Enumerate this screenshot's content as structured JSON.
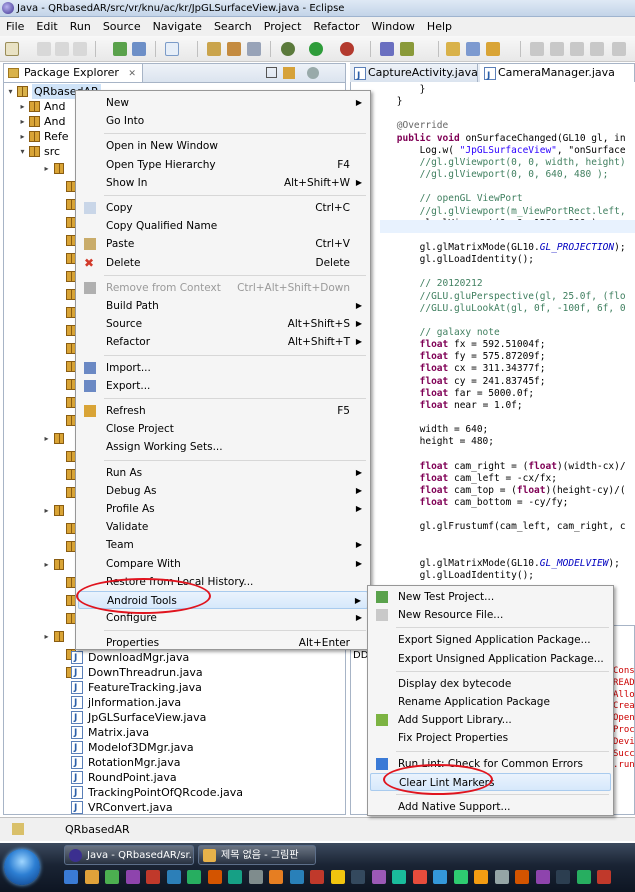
{
  "window": {
    "title": "Java - QRbasedAR/src/vr/knu/ac/kr/JpGLSurfaceView.java - Eclipse"
  },
  "menubar": [
    "File",
    "Edit",
    "Run",
    "Source",
    "Navigate",
    "Search",
    "Project",
    "Refactor",
    "Window",
    "Help"
  ],
  "package_explorer": {
    "tab_label": "Package Explorer",
    "project": "QRbasedAR",
    "top_items": [
      "And",
      "And",
      "Refe",
      "src"
    ],
    "files": [
      "DownloadMgr.java",
      "DownThreadrun.java",
      "FeatureTracking.java",
      "jlnformation.java",
      "JpGLSurfaceView.java",
      "Matrix.java",
      "Modelof3DMgr.java",
      "RotationMgr.java",
      "RoundPoint.java",
      "TrackingPointOfQRcode.java",
      "VRConvert.java"
    ]
  },
  "editor": {
    "tabs": [
      "CaptureActivity.java",
      "CameraManager.java"
    ],
    "lines": [
      {
        "t": "            }"
      },
      {
        "t": "        }"
      },
      {
        "t": ""
      },
      {
        "t": "        @Override",
        "c": "an"
      },
      {
        "t": "        public void onSurfaceChanged(GL10 gl, in"
      },
      {
        "t": "            Log.w( \"JpGLSurfaceView\", \"onSurface"
      },
      {
        "t": "            //gl.glViewport(0, 0, width, height)",
        "c": "cm"
      },
      {
        "t": "            //gl.glViewport(0, 0, 640, 480 );",
        "c": "cm"
      },
      {
        "t": ""
      },
      {
        "t": "            // openGL ViewPort",
        "c": "cm"
      },
      {
        "t": "            //gl.glViewport(m_ViewPortRect.left,",
        "c": "cm"
      },
      {
        "t": "            gl.glViewport(0, 0, 1280, 800 );"
      },
      {
        "t": ""
      },
      {
        "t": "            gl.glMatrixMode(GL10.GL_PROJECTION);"
      },
      {
        "t": "            gl.glLoadIdentity();"
      },
      {
        "t": ""
      },
      {
        "t": "            // 20120212",
        "c": "cm"
      },
      {
        "t": "            //GLU.gluPerspective(gl, 25.0f, (flo",
        "c": "cm"
      },
      {
        "t": "            //GLU.gluLookAt(gl, 0f, -100f, 6f, 0",
        "c": "cm"
      },
      {
        "t": ""
      },
      {
        "t": "            // galaxy note",
        "c": "cm"
      },
      {
        "t": "            float fx = 592.51004f;"
      },
      {
        "t": "            float fy = 575.87209f;"
      },
      {
        "t": "            float cx = 311.34377f;"
      },
      {
        "t": "            float cy = 241.83745f;"
      },
      {
        "t": "            float far = 5000.0f;"
      },
      {
        "t": "            float near = 1.0f;"
      },
      {
        "t": ""
      },
      {
        "t": "            width = 640;"
      },
      {
        "t": "            height = 480;"
      },
      {
        "t": ""
      },
      {
        "t": "            float cam_right = (float)(width-cx)/"
      },
      {
        "t": "            float cam_left = -cx/fx;"
      },
      {
        "t": "            float cam_top = (float)(height-cy)/("
      },
      {
        "t": "            float cam_bottom = -cy/fy;"
      },
      {
        "t": ""
      },
      {
        "t": "            gl.glFrustumf(cam_left, cam_right, c"
      },
      {
        "t": ""
      },
      {
        "t": ""
      },
      {
        "t": "            gl.glMatrixMode(GL10.GL_MODELVIEW);"
      },
      {
        "t": "            gl.glLoadIdentity();"
      }
    ]
  },
  "console_fragments": [
    "Conso",
    "READ",
    "Alloc",
    "Creat",
    "OpenG",
    "Proce",
    "Devic",
    "Succe",
    ".run"
  ],
  "lower_panel_label": "DD",
  "context_menu": [
    {
      "label": "New",
      "sub": true
    },
    {
      "label": "Go Into"
    },
    {
      "sep": true
    },
    {
      "label": "Open in New Window"
    },
    {
      "label": "Open Type Hierarchy",
      "shortcut": "F4"
    },
    {
      "label": "Show In",
      "shortcut": "Alt+Shift+W",
      "sub": true
    },
    {
      "sep": true
    },
    {
      "label": "Copy",
      "shortcut": "Ctrl+C",
      "icon": "copy-icon"
    },
    {
      "label": "Copy Qualified Name"
    },
    {
      "label": "Paste",
      "shortcut": "Ctrl+V",
      "icon": "paste-icon"
    },
    {
      "label": "Delete",
      "shortcut": "Delete",
      "icon": "delete-icon"
    },
    {
      "sep": true
    },
    {
      "label": "Remove from Context",
      "shortcut": "Ctrl+Alt+Shift+Down",
      "disabled": true,
      "icon": "remove-context-icon"
    },
    {
      "label": "Build Path",
      "sub": true
    },
    {
      "label": "Source",
      "shortcut": "Alt+Shift+S",
      "sub": true
    },
    {
      "label": "Refactor",
      "shortcut": "Alt+Shift+T",
      "sub": true
    },
    {
      "sep": true
    },
    {
      "label": "Import...",
      "icon": "import-icon"
    },
    {
      "label": "Export...",
      "icon": "export-icon"
    },
    {
      "sep": true
    },
    {
      "label": "Refresh",
      "shortcut": "F5",
      "icon": "refresh-icon"
    },
    {
      "label": "Close Project"
    },
    {
      "label": "Assign Working Sets..."
    },
    {
      "sep": true
    },
    {
      "label": "Run As",
      "sub": true
    },
    {
      "label": "Debug As",
      "sub": true
    },
    {
      "label": "Profile As",
      "sub": true
    },
    {
      "label": "Validate"
    },
    {
      "label": "Team",
      "sub": true
    },
    {
      "label": "Compare With",
      "sub": true
    },
    {
      "label": "Restore from Local History..."
    },
    {
      "label": "Android Tools",
      "sub": true,
      "active": true
    },
    {
      "label": "Configure",
      "sub": true
    },
    {
      "sep": true
    },
    {
      "label": "Properties",
      "shortcut": "Alt+Enter"
    }
  ],
  "submenu": [
    {
      "label": "New Test Project...",
      "icon": "new-test-project-icon"
    },
    {
      "label": "New Resource File...",
      "icon": "new-resource-file-icon"
    },
    {
      "sep": true
    },
    {
      "label": "Export Signed Application Package..."
    },
    {
      "label": "Export Unsigned Application Package..."
    },
    {
      "sep": true
    },
    {
      "label": "Display dex bytecode"
    },
    {
      "label": "Rename Application Package"
    },
    {
      "label": "Add Support Library...",
      "icon": "android-icon"
    },
    {
      "label": "Fix Project Properties"
    },
    {
      "sep": true
    },
    {
      "label": "Run Lint: Check for Common Errors",
      "icon": "lint-check-icon"
    },
    {
      "label": "Clear Lint Markers",
      "active": true
    },
    {
      "sep": true
    },
    {
      "label": "Add Native Support..."
    }
  ],
  "statusbar": {
    "text": "QRbasedAR"
  },
  "taskbar": {
    "tasks": [
      "Java - QRbasedAR/sr...",
      "제목 없음 - 그림판"
    ]
  }
}
